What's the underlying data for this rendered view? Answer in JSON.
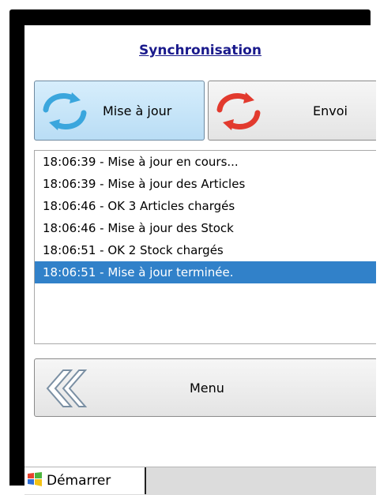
{
  "header": {
    "title": "Synchronisation"
  },
  "toolbar": {
    "update_label": "Mise à jour",
    "update_icon": "sync-arrows-blue-icon",
    "send_label": "Envoi",
    "send_icon": "sync-arrows-red-icon"
  },
  "log": {
    "lines": [
      "18:06:39 - Mise à jour en cours...",
      "18:06:39 - Mise à jour des Articles",
      "18:06:46 -  OK 3 Articles chargés",
      "18:06:46 - Mise à jour des Stock",
      "18:06:51 -  OK 2 Stock chargés",
      "18:06:51 - Mise à jour terminée."
    ],
    "selected_index": 5
  },
  "menu": {
    "label": "Menu",
    "icon": "back-chevrons-icon"
  },
  "taskbar": {
    "start_label": "Démarrer",
    "start_icon": "windows-flag-icon"
  },
  "colors": {
    "title": "#1a1a8c",
    "selection": "#3181c9",
    "update_button_bg": "#c6e6fa"
  }
}
